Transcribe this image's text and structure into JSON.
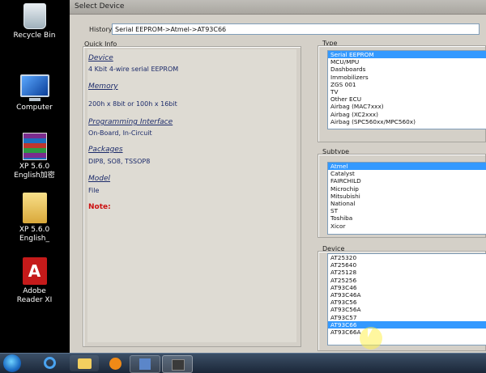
{
  "desktop": {
    "icons": [
      {
        "label": "Recycle Bin"
      },
      {
        "label": "Computer"
      },
      {
        "label": "XP 5.6.0 English加密"
      },
      {
        "label": "XP 5.6.0 English_"
      },
      {
        "label": "Adobe Reader XI"
      }
    ]
  },
  "window": {
    "title": "Select Device",
    "history_label": "History:",
    "history_value": "Serial EEPROM->Atmel->AT93C66",
    "quick_info_label": "Quick Info",
    "quick_info": {
      "device_heading": "Device",
      "device_value": "4 Kbit 4-wire serial EEPROM",
      "memory_heading": "Memory",
      "memory_value": "200h x 8bit or 100h x 16bit",
      "interface_heading": "Programming Interface",
      "interface_value": "On-Board, In-Circuit",
      "packages_heading": "Packages",
      "packages_value": "DIP8, SO8, TSSOP8",
      "model_heading": "Model",
      "model_value": "File",
      "note_label": "Note:"
    },
    "type_label": "Type",
    "type_items": [
      "Serial EEPROM",
      "MCU/MPU",
      "Dashboards",
      "Immobilizers",
      "ZGS 001",
      "TV",
      "Other ECU",
      "Airbag (MAC7xxx)",
      "Airbag (XC2xxx)",
      "Airbag (SPC560xx/MPC560x)"
    ],
    "type_selected": "Serial EEPROM",
    "subtype_label": "Subtype",
    "subtype_items": [
      "Atmel",
      "Catalyst",
      "FAIRCHILD",
      "Microchip",
      "Mitsubishi",
      "National",
      "ST",
      "Toshiba",
      "Xicor"
    ],
    "subtype_selected": "Atmel",
    "device_label": "Device",
    "device_items": [
      "AT25320",
      "AT25640",
      "AT25128",
      "AT25256",
      "AT93C46",
      "AT93C46A",
      "AT93C56",
      "AT93C56A",
      "AT93C57",
      "AT93C66",
      "AT93C66A"
    ],
    "device_selected": "AT93C66"
  },
  "colors": {
    "selection": "#3399ff",
    "info_text": "#1c2b6a",
    "note_red": "#cc1111",
    "window_bg": "#d4d0c8"
  },
  "taskbar": {
    "icons": [
      "start-orb-icon",
      "internet-explorer-icon",
      "folder-icon",
      "media-player-icon",
      "device-app-icon",
      "chip-app-icon"
    ]
  }
}
